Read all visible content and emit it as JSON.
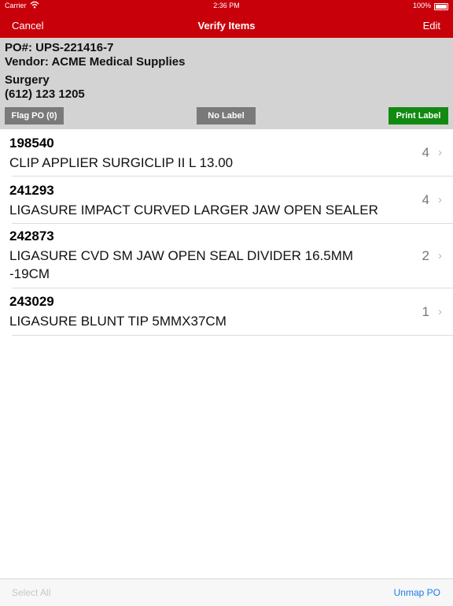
{
  "status_bar": {
    "carrier": "Carrier",
    "wifi_icon": "wifi-icon",
    "time": "2:36 PM",
    "battery": "100%"
  },
  "nav": {
    "cancel_label": "Cancel",
    "title": "Verify Items",
    "edit_label": "Edit"
  },
  "po": {
    "number": "PO#: UPS-221416-7",
    "vendor": "Vendor: ACME Medical Supplies",
    "department": "Surgery",
    "phone": "(612) 123 1205"
  },
  "buttons": {
    "flag_po": "Flag PO (0)",
    "no_label": "No Label",
    "print_label": "Print Label"
  },
  "items": [
    {
      "code": "198540",
      "desc_lines": [
        "CLIP APPLIER SURGICLIP II L 13.00"
      ],
      "qty": "4"
    },
    {
      "code": "241293",
      "desc_lines": [
        "LIGASURE IMPACT CURVED LARGER JAW OPEN SEALER"
      ],
      "qty": "4"
    },
    {
      "code": "242873",
      "desc_lines": [
        "LIGASURE CVD SM JAW OPEN SEAL DIVIDER 16.5MM",
        "-19CM"
      ],
      "qty": "2"
    },
    {
      "code": "243029",
      "desc_lines": [
        "LIGASURE BLUNT TIP 5MMX37CM"
      ],
      "qty": "1"
    }
  ],
  "toolbar": {
    "select_all": "Select All",
    "unmap_po": "Unmap PO"
  },
  "colors": {
    "nav_red": "#c8000a",
    "header_gray": "#d3d3d3",
    "button_gray": "#7a7a7a",
    "print_green": "#128a12",
    "link_blue": "#1a7ae8"
  }
}
